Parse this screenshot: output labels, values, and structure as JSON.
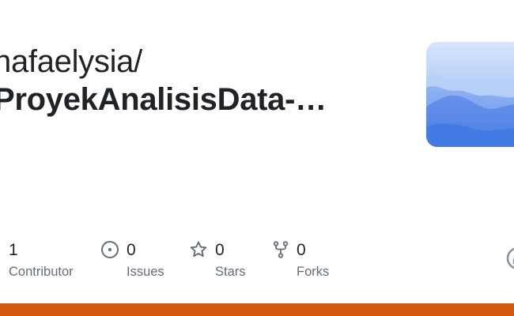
{
  "repo": {
    "owner": "hafaelysia/",
    "name": "ProyekAnalisisData-…"
  },
  "stats": {
    "contributors": {
      "value": "1",
      "label": "Contributor"
    },
    "issues": {
      "value": "0",
      "label": "Issues"
    },
    "stars": {
      "value": "0",
      "label": "Stars"
    },
    "forks": {
      "value": "0",
      "label": "Forks"
    }
  },
  "icons": {
    "issues": "issue-opened-icon",
    "stars": "star-icon",
    "forks": "repo-forked-icon",
    "brand": "github-logo-icon"
  },
  "colors": {
    "language_bar": "#d4590f",
    "text_primary": "#1f2328",
    "text_muted": "#656d76",
    "thumb_sky": "#b9d3f7",
    "thumb_mountain": "#4d82e6"
  }
}
